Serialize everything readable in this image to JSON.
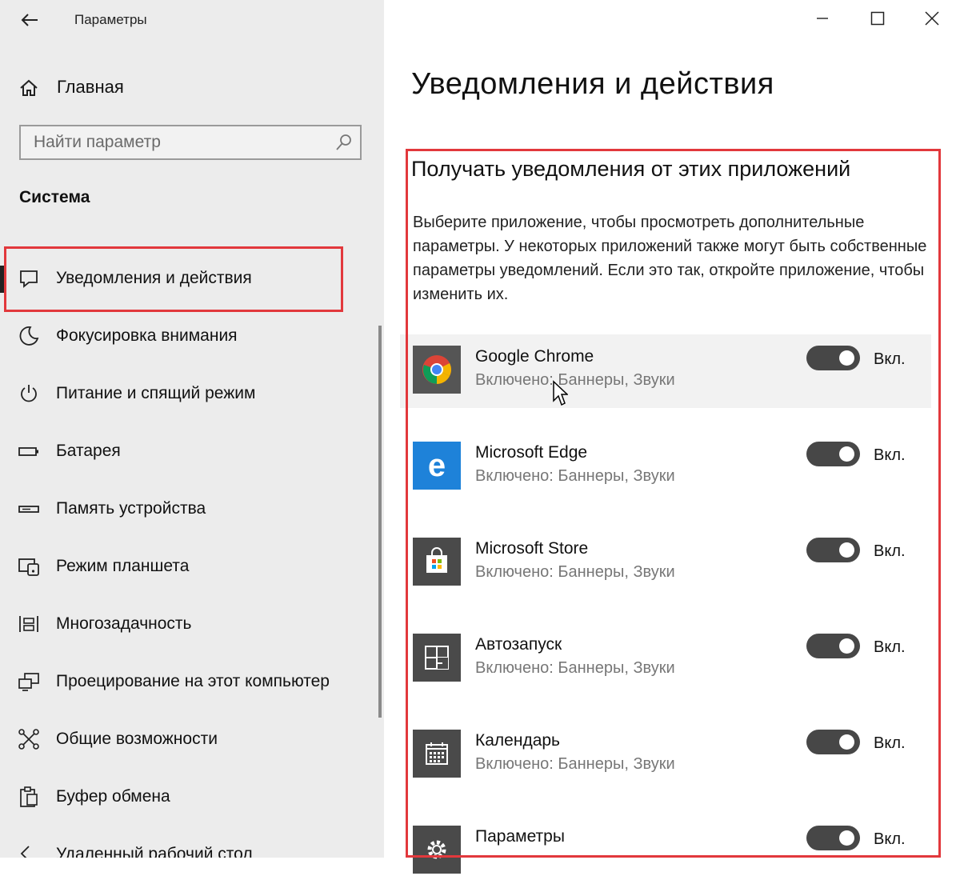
{
  "window": {
    "title": "Параметры"
  },
  "sidebar": {
    "home_label": "Главная",
    "search_placeholder": "Найти параметр",
    "section_title": "Система",
    "items": [
      {
        "label": "Уведомления и действия",
        "icon": "notification-icon",
        "active": true
      },
      {
        "label": "Фокусировка внимания",
        "icon": "moon-icon"
      },
      {
        "label": "Питание и спящий режим",
        "icon": "power-icon"
      },
      {
        "label": "Батарея",
        "icon": "battery-icon"
      },
      {
        "label": "Память устройства",
        "icon": "storage-icon"
      },
      {
        "label": "Режим планшета",
        "icon": "tablet-icon"
      },
      {
        "label": "Многозадачность",
        "icon": "multitask-icon"
      },
      {
        "label": "Проецирование на этот компьютер",
        "icon": "project-icon"
      },
      {
        "label": "Общие возможности",
        "icon": "shared-icon"
      },
      {
        "label": "Буфер обмена",
        "icon": "clipboard-icon"
      },
      {
        "label": "Удаленный рабочий стол",
        "icon": "remote-desktop-icon"
      }
    ]
  },
  "main": {
    "title": "Уведомления и действия",
    "subtitle": "Получать уведомления от этих приложений",
    "description": "Выберите приложение, чтобы просмотреть дополнительные параметры. У некоторых приложений также могут быть собственные параметры уведомлений. Если это так, откройте приложение, чтобы изменить их.",
    "apps": [
      {
        "name": "Google Chrome",
        "status": "Включено: Баннеры, Звуки",
        "toggle_label": "Вкл.",
        "icon": "chrome-icon"
      },
      {
        "name": "Microsoft Edge",
        "status": "Включено: Баннеры, Звуки",
        "toggle_label": "Вкл.",
        "icon": "edge-icon"
      },
      {
        "name": "Microsoft Store",
        "status": "Включено: Баннеры, Звуки",
        "toggle_label": "Вкл.",
        "icon": "store-icon"
      },
      {
        "name": "Автозапуск",
        "status": "Включено: Баннеры, Звуки",
        "toggle_label": "Вкл.",
        "icon": "autoplay-icon"
      },
      {
        "name": "Календарь",
        "status": "Включено: Баннеры, Звуки",
        "toggle_label": "Вкл.",
        "icon": "calendar-icon"
      },
      {
        "name": "Параметры",
        "status": "",
        "toggle_label": "Вкл.",
        "icon": "settings-gear-icon"
      }
    ]
  },
  "colors": {
    "highlight": "#e2383c",
    "toggle_on": "#474747",
    "edge_blue": "#1e82d9",
    "tile_dark": "#4a4a4a"
  }
}
